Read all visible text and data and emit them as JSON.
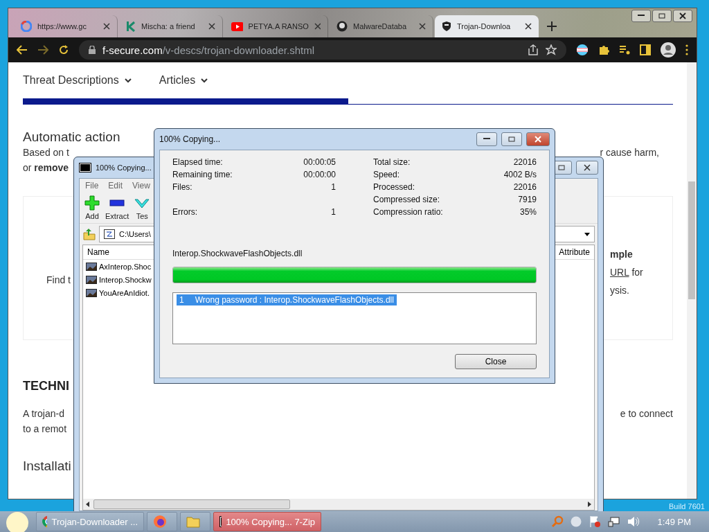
{
  "browser": {
    "tabs": [
      {
        "title": "https://www.gc",
        "kind": "ring",
        "selected": false
      },
      {
        "title": "Mischa: a friend",
        "kind": "letter",
        "selected": false
      },
      {
        "title": "PETYA.A RANSO",
        "kind": "play",
        "selected": false
      },
      {
        "title": "MalwareDataba",
        "kind": "cat",
        "selected": false
      },
      {
        "title": "Trojan-Downloa",
        "kind": "shield",
        "selected": true
      }
    ],
    "address": {
      "domain": "f-secure.com",
      "path": "/v-descs/trojan-downloader.shtml"
    },
    "page": {
      "nav": [
        "Threat Descriptions",
        "Articles"
      ],
      "heading": "Automatic action",
      "intro": [
        {
          "left": "Based on t",
          "right": "r cause harm,"
        },
        {
          "left": "or **remove**"
        }
      ],
      "card": {
        "left": "Find t",
        "right": [
          {
            "kind": "bold",
            "text": "mple"
          },
          {
            "kind": "link",
            "link": "URL",
            "text": " for"
          },
          {
            "kind": "plain",
            "text": "ysis."
          }
        ]
      },
      "technical": {
        "heading": "TECHNI",
        "lines": [
          {
            "left": "A trojan-d",
            "right": "e to connect"
          },
          {
            "left": "to a remot"
          }
        ]
      },
      "installation_heading": "Installati"
    }
  },
  "archiver": {
    "title": "100% Copying...",
    "menu": [
      "File",
      "Edit",
      "View"
    ],
    "toolbar": [
      {
        "kind": "add",
        "label": "Add"
      },
      {
        "kind": "extract",
        "label": "Extract"
      },
      {
        "kind": "test",
        "label": "Tes"
      }
    ],
    "path": "C:\\Users\\",
    "columns": [
      "Name",
      "Attribute"
    ],
    "rows": [
      "AxInterop.Shoc",
      "Interop.Shockw",
      "YouAreAnIdiot."
    ]
  },
  "dialog": {
    "title": "100% Copying...",
    "left_stats": [
      {
        "label": "Elapsed time:",
        "value": "00:00:05"
      },
      {
        "label": "Remaining time:",
        "value": "00:00:00"
      },
      {
        "label": "Files:",
        "value": "1"
      }
    ],
    "errors": {
      "label": "Errors:",
      "value": "1"
    },
    "right_stats": [
      {
        "label": "Total size:",
        "value": "22016"
      },
      {
        "label": "Speed:",
        "value": "4002 B/s"
      },
      {
        "label": "Processed:",
        "value": "22016"
      },
      {
        "label": "Compressed size:",
        "value": "7919"
      },
      {
        "label": "Compression ratio:",
        "value": "35%"
      }
    ],
    "current_file": "Interop.ShockwaveFlashObjects.dll",
    "progress": {
      "level": 1
    },
    "messages": [
      {
        "index": "1",
        "text": "Wrong password : Interop.ShockwaveFlashObjects.dll",
        "selected": true
      }
    ],
    "button": "Close"
  },
  "desktop_text": "Build 7601",
  "taskbar": {
    "items": [
      {
        "kind": "chrome",
        "label": "Trojan-Downloader ...",
        "selected": false
      },
      {
        "kind": "firefox",
        "selected": false
      },
      {
        "kind": "folder",
        "selected": false
      },
      {
        "kind": "sevenzip",
        "label": "100% Copying... 7-Zip",
        "selected": true
      }
    ],
    "clock": "1:49 PM"
  }
}
